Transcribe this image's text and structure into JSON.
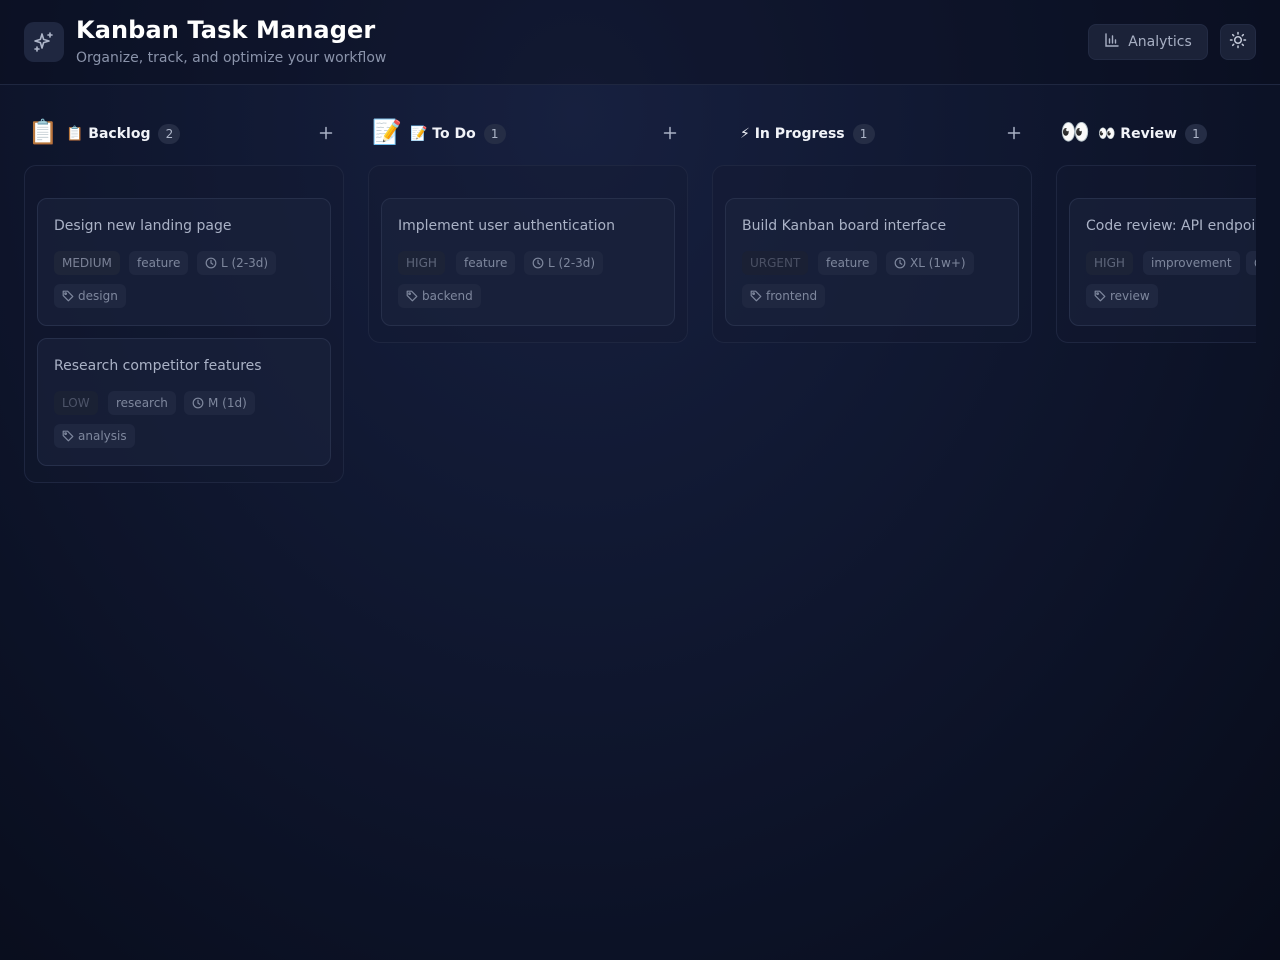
{
  "header": {
    "title": "Kanban Task Manager",
    "subtitle": "Organize, track, and optimize your workflow",
    "logo_icon": "sparkles-icon",
    "analytics_label": "Analytics",
    "theme_icon": "sun-icon"
  },
  "columns": [
    {
      "emoji": "📋",
      "title": "📋 Backlog",
      "count": "2",
      "cards": [
        {
          "title": "Design new landing page",
          "priority": "MEDIUM",
          "type": "feature",
          "estimate": "L (2-3d)",
          "tag": "design"
        },
        {
          "title": "Research competitor features",
          "priority": "LOW",
          "type": "research",
          "estimate": "M (1d)",
          "tag": "analysis"
        }
      ]
    },
    {
      "emoji": "📝",
      "title": "📝 To Do",
      "count": "1",
      "cards": [
        {
          "title": "Implement user authentication",
          "priority": "HIGH",
          "type": "feature",
          "estimate": "L (2-3d)",
          "tag": "backend"
        }
      ]
    },
    {
      "emoji": "",
      "title": "⚡ In Progress",
      "count": "1",
      "cards": [
        {
          "title": "Build Kanban board interface",
          "priority": "URGENT",
          "type": "feature",
          "estimate": "XL (1w+)",
          "tag": "frontend"
        }
      ]
    },
    {
      "emoji": "👀",
      "title": "👀 Review",
      "count": "1",
      "cards": [
        {
          "title": "Code review: API endpoints",
          "priority": "HIGH",
          "type": "improvement",
          "estimate": "",
          "tag": "review"
        }
      ]
    }
  ],
  "colors": {
    "background": "#0c1226",
    "card": "#1c243e",
    "chip": "#1f2740",
    "accent_text": "#ffffff"
  }
}
